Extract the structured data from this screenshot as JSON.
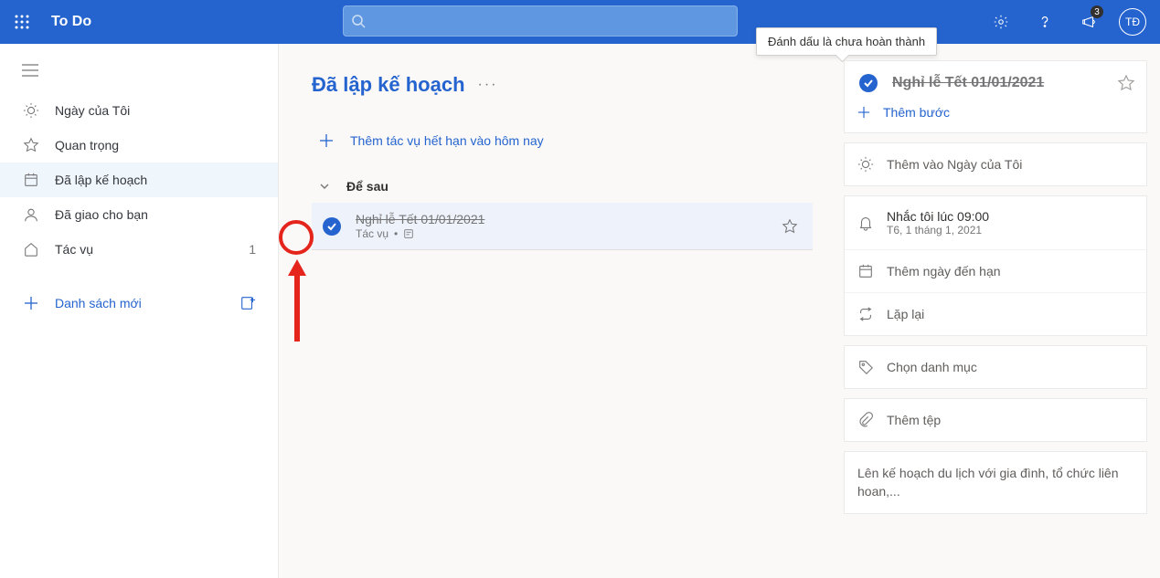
{
  "header": {
    "brand": "To Do",
    "avatar_initials": "TĐ",
    "notification_count": "3",
    "search_placeholder": ""
  },
  "tooltip": "Đánh dấu là chưa hoàn thành",
  "sidebar": {
    "items": [
      {
        "label": "Ngày của Tôi"
      },
      {
        "label": "Quan trọng"
      },
      {
        "label": "Đã lập kế hoạch"
      },
      {
        "label": "Đã giao cho bạn"
      },
      {
        "label": "Tác vụ",
        "count": "1"
      }
    ],
    "new_list": "Danh sách mới"
  },
  "main": {
    "title": "Đã lập kế hoạch",
    "add_task": "Thêm tác vụ hết hạn vào hôm nay",
    "group_label": "Để sau",
    "task": {
      "title": "Nghỉ lễ Tết 01/01/2021",
      "meta_list": "Tác vụ"
    }
  },
  "detail": {
    "title": "Nghỉ lễ Tết 01/01/2021",
    "add_step": "Thêm bước",
    "add_my_day": "Thêm vào Ngày của Tôi",
    "reminder_title": "Nhắc tôi lúc 09:00",
    "reminder_sub": "T6, 1 tháng 1, 2021",
    "due_date": "Thêm ngày đến hạn",
    "repeat": "Lặp lại",
    "category": "Chọn danh mục",
    "add_file": "Thêm tệp",
    "note": "Lên kế hoạch du lịch với gia đình, tổ chức liên hoan,..."
  }
}
